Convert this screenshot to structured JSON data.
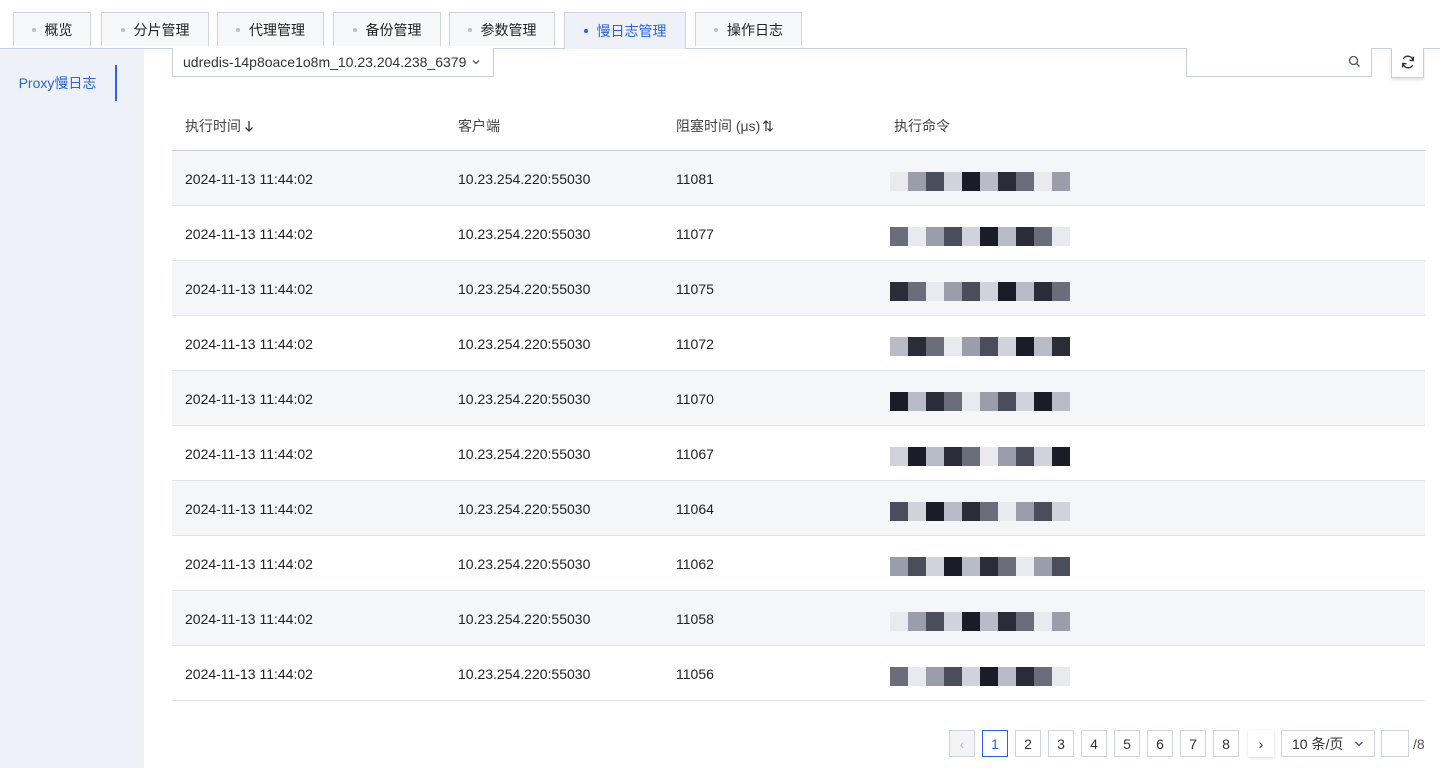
{
  "tabs": [
    {
      "label": "概览"
    },
    {
      "label": "分片管理"
    },
    {
      "label": "代理管理"
    },
    {
      "label": "备份管理"
    },
    {
      "label": "参数管理"
    },
    {
      "label": "慢日志管理"
    },
    {
      "label": "操作日志"
    }
  ],
  "active_tab_index": 5,
  "sidebar": {
    "items": [
      {
        "label": "Proxy慢日志"
      }
    ]
  },
  "instance_select": {
    "value": "udredis-14p8oace1o8m_10.23.204.238_6379",
    "icon": "chevron-down-icon"
  },
  "search": {
    "placeholder": "",
    "icon": "search-icon"
  },
  "refresh": {
    "icon": "refresh-icon"
  },
  "table": {
    "headers": [
      "执行时间",
      "客户端",
      "阻塞时间 (μs)",
      "执行命令"
    ],
    "rows": [
      {
        "time": "2024-11-13 11:44:02",
        "client": "10.23.254.220:55030",
        "block": "11081",
        "cmd": ""
      },
      {
        "time": "2024-11-13 11:44:02",
        "client": "10.23.254.220:55030",
        "block": "11077",
        "cmd": ""
      },
      {
        "time": "2024-11-13 11:44:02",
        "client": "10.23.254.220:55030",
        "block": "11075",
        "cmd": ""
      },
      {
        "time": "2024-11-13 11:44:02",
        "client": "10.23.254.220:55030",
        "block": "11072",
        "cmd": ""
      },
      {
        "time": "2024-11-13 11:44:02",
        "client": "10.23.254.220:55030",
        "block": "11070",
        "cmd": ""
      },
      {
        "time": "2024-11-13 11:44:02",
        "client": "10.23.254.220:55030",
        "block": "11067",
        "cmd": ""
      },
      {
        "time": "2024-11-13 11:44:02",
        "client": "10.23.254.220:55030",
        "block": "11064",
        "cmd": ""
      },
      {
        "time": "2024-11-13 11:44:02",
        "client": "10.23.254.220:55030",
        "block": "11062",
        "cmd": ""
      },
      {
        "time": "2024-11-13 11:44:02",
        "client": "10.23.254.220:55030",
        "block": "11058",
        "cmd": ""
      },
      {
        "time": "2024-11-13 11:44:02",
        "client": "10.23.254.220:55030",
        "block": "11056",
        "cmd": ""
      }
    ]
  },
  "pagination": {
    "prev_label": "‹",
    "pages": [
      "1",
      "2",
      "3",
      "4",
      "5",
      "6",
      "7",
      "8"
    ],
    "current_page": "1",
    "next_label": "›",
    "page_size_label": "10 条/页",
    "jump_value": "",
    "total_label": "/8"
  },
  "colors": {
    "accent": "#2a64e6",
    "sidebar_bg": "#eef1f8",
    "stripe": "#f5f6fa"
  }
}
